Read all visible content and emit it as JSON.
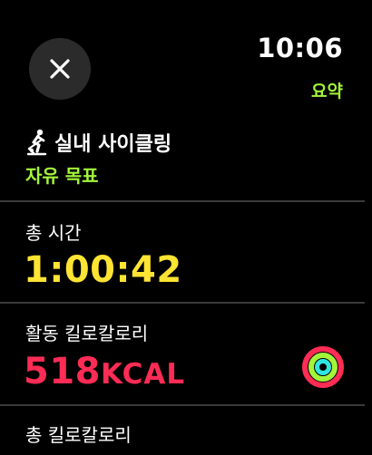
{
  "status": {
    "time": "10:06",
    "summary_link": "요약"
  },
  "workout": {
    "icon": "indoor-cycle-icon",
    "title": "실내 사이클링",
    "goal": "자유 목표"
  },
  "metrics": [
    {
      "label": "총 시간",
      "value": "1:00:42",
      "color": "#ffe433"
    },
    {
      "label": "활동 킬로칼로리",
      "value": "518",
      "unit": "KCAL",
      "color": "#ff2c55"
    },
    {
      "label": "총 킬로칼로리"
    }
  ],
  "colors": {
    "accent_green": "#a3f53a",
    "time_yellow": "#ffe433",
    "kcal_red": "#ff2c55",
    "ring_move": "#ff2c55",
    "ring_exercise": "#a3f53a",
    "ring_stand": "#2fe6e0"
  }
}
